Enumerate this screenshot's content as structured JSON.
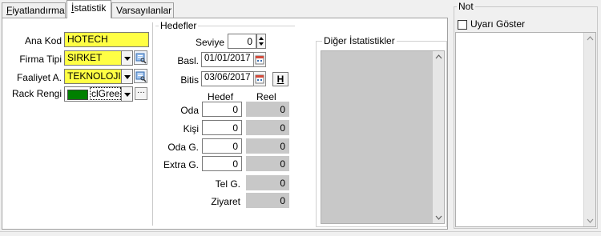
{
  "tabs": [
    {
      "label": "Fiyatlandırma",
      "mnemonic": "F",
      "rest": "iyatlandırma"
    },
    {
      "label": "İstatistik",
      "mnemonic": "İ",
      "rest": "statistik"
    },
    {
      "label": "Varsayılanlar"
    }
  ],
  "left": {
    "ana_kod": {
      "label": "Ana Kod",
      "value": "HOTECH"
    },
    "firma_tipi": {
      "label": "Firma Tipi",
      "value": "SIRKET"
    },
    "faaliyet": {
      "label": "Faaliyet A.",
      "value": "TEKNOLOJI"
    },
    "rack_rengi": {
      "label": "Rack Rengi",
      "value": "clGree",
      "color": "#008000"
    }
  },
  "hedefler": {
    "title": "Hedefler",
    "seviye": {
      "label": "Seviye",
      "value": "0"
    },
    "basl": {
      "label": "Basl.",
      "value": "01/01/2017"
    },
    "bitis": {
      "label": "Bitis",
      "value": "03/06/2017"
    },
    "h_button": "H",
    "col_hedef": "Hedef",
    "col_reel": "Reel",
    "rows": [
      {
        "label": "Oda",
        "hedef": "0",
        "reel": "0"
      },
      {
        "label": "Kişi",
        "hedef": "0",
        "reel": "0"
      },
      {
        "label": "Oda G.",
        "hedef": "0",
        "reel": "0"
      },
      {
        "label": "Extra G.",
        "hedef": "0",
        "reel": "0"
      }
    ],
    "tel": {
      "label": "Tel G.",
      "reel": "0"
    },
    "ziyaret": {
      "label": "Ziyaret",
      "reel": "0"
    }
  },
  "diger": {
    "title": "Diğer İstatistikler"
  },
  "not": {
    "title": "Not",
    "checkbox_label": "Uyarı Göster",
    "checked": false
  }
}
